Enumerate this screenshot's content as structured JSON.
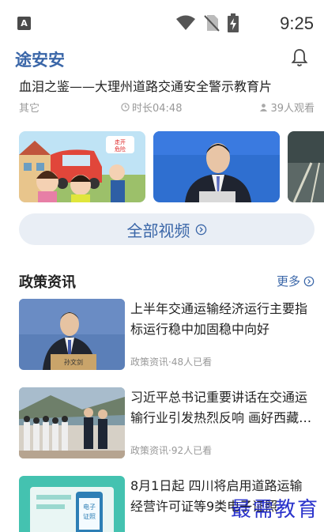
{
  "status_bar": {
    "time": "9:25",
    "notification_glyph": "A",
    "icons": [
      "wifi-icon",
      "no-sim-icon",
      "battery-charging-icon"
    ]
  },
  "header": {
    "app_title": "途安安",
    "bell_icon": "bell-icon"
  },
  "featured_video": {
    "title": "血泪之鉴——大理州道路交通安全警示教育片",
    "category": "其它",
    "duration": "时长04:48",
    "views": "39人观看"
  },
  "all_videos_label": "全部视频",
  "policy_section": {
    "title": "政策资讯",
    "more_label": "更多",
    "items": [
      {
        "title": "上半年交通运输经济运行主要指标运行稳中加固稳中向好",
        "meta": "政策资讯·48人已看"
      },
      {
        "title": "习近平总书记重要讲话在交通运输行业引发热烈反响 画好西藏…",
        "meta": "政策资讯·92人已看"
      },
      {
        "title": "8月1日起 四川将启用道路运输经营许可证等9类电子证照",
        "meta": ""
      }
    ]
  },
  "thumb_text": {
    "sign": "走开 危险",
    "nameplate": "孙文剑",
    "phone_label": "电子 证照"
  },
  "watermark": "最需教育",
  "colors": {
    "accent": "#3a66a8",
    "pill_bg": "#e9eef5",
    "meta_gray": "#999999",
    "watermark": "#1a23c8"
  }
}
